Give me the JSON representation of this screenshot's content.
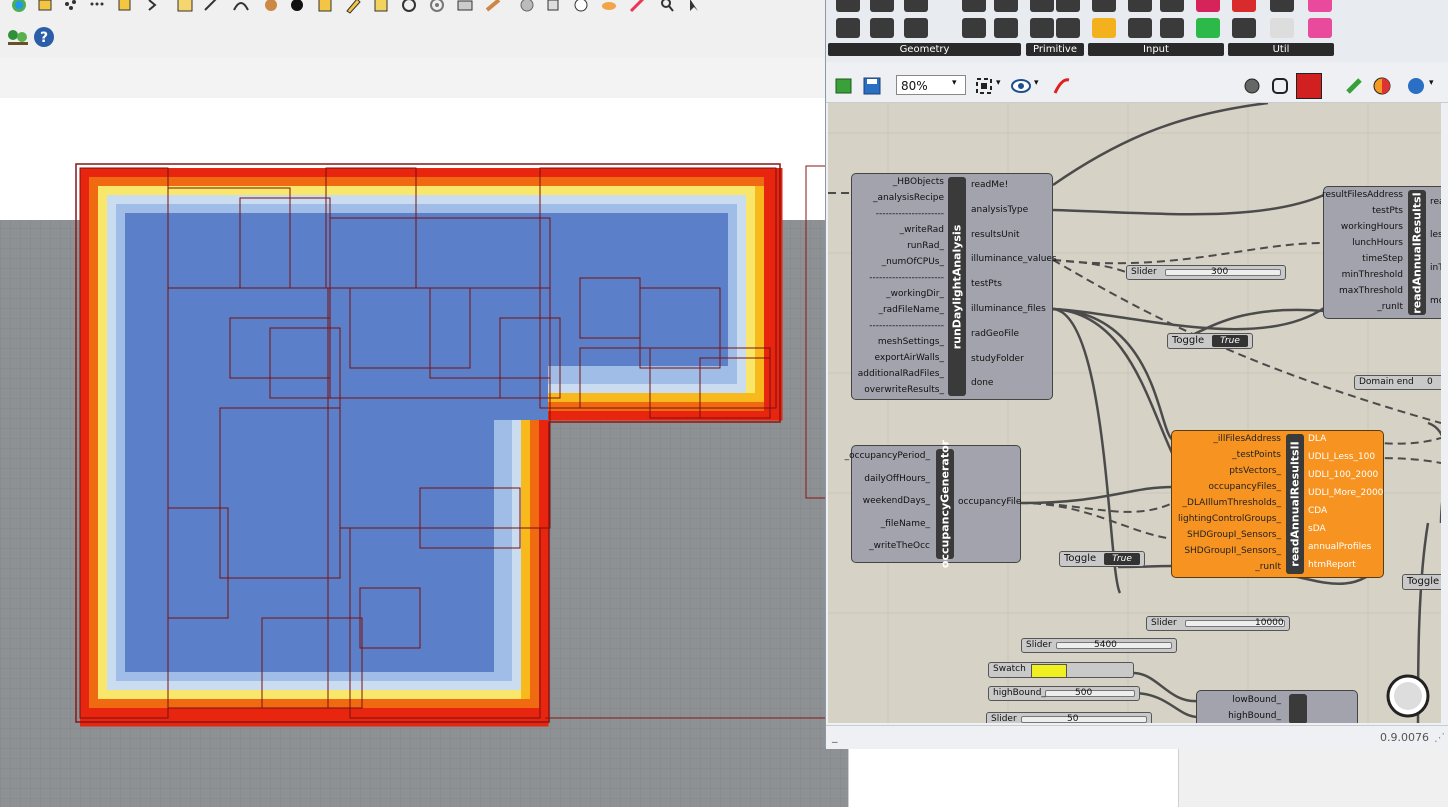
{
  "rhino": {
    "toolbar2": {
      "help_icon": "help-icon",
      "tree_icon": "tree-icon"
    }
  },
  "gh": {
    "ribbon": {
      "groups": [
        {
          "label": "Geometry"
        },
        {
          "label": "Primitive"
        },
        {
          "label": "Input"
        },
        {
          "label": "Util"
        }
      ]
    },
    "toolbar": {
      "zoom": "80%"
    },
    "status": {
      "version": "0.9.0076"
    },
    "components": {
      "run_daylight": {
        "title": "runDaylightAnalysis",
        "inputs": [
          "_HBObjects",
          "_analysisRecipe",
          "---------------------",
          "_writeRad",
          "runRad_",
          "_numOfCPUs_",
          "-----------------------",
          "_workingDir_",
          "_radFileName_",
          "-----------------------",
          "meshSettings_",
          "exportAirWalls_",
          "additionalRadFiles_",
          "overwriteResults_"
        ],
        "outputs": [
          "readMe!",
          "analysisType",
          "resultsUnit",
          "illuminance_values",
          "testPts",
          "illuminance_files",
          "radGeoFile",
          "studyFolder",
          "done"
        ]
      },
      "occupancy": {
        "title": "occupancyGenerator",
        "inputs": [
          "_occupancyPeriod_",
          "dailyOffHours_",
          "weekendDays_",
          "_fileName_",
          "_writeTheOcc"
        ],
        "outputs": [
          "occupancyFile"
        ]
      },
      "read_annual_2": {
        "title": "readAnnualResultsII",
        "inputs": [
          "_illFilesAddress",
          "_testPoints",
          "ptsVectors_",
          "occupancyFiles_",
          "_DLAIllumThresholds_",
          "lightingControlGroups_",
          "SHDGroupI_Sensors_",
          "SHDGroupII_Sensors_",
          "_runIt"
        ],
        "outputs": [
          "DLA",
          "UDLI_Less_100",
          "UDLI_100_2000",
          "UDLI_More_2000",
          "CDA",
          "sDA",
          "annualProfiles",
          "htmReport"
        ]
      },
      "read_annual_1": {
        "title": "readAnnualResultsI",
        "inputs": [
          "resultFilesAddress",
          "testPts",
          "workingHours",
          "lunchHours",
          "timeStep",
          "minThreshold",
          "maxThreshold",
          "_runIt"
        ],
        "outputs": [
          "read",
          "less",
          "inTh",
          "more"
        ]
      },
      "bounds": {
        "inputs": [
          "lowBound_",
          "highBound_"
        ]
      }
    },
    "params": {
      "slider_300": {
        "label": "Slider",
        "value": "300"
      },
      "slider_10000": {
        "label": "Slider",
        "value": "10000"
      },
      "slider_5400": {
        "label": "Slider",
        "value": "5400"
      },
      "slider_50": {
        "label": "Slider",
        "value": "50"
      },
      "highbound": {
        "label": "highBound_",
        "value": "500"
      },
      "swatch": {
        "label": "Swatch",
        "color": "#f0f020"
      },
      "toggle_a": {
        "label": "Toggle",
        "value": "True"
      },
      "toggle_b": {
        "label": "Toggle",
        "value": "True"
      },
      "toggle_c": {
        "label": "Toggle"
      },
      "domain_end": {
        "label": "Domain end",
        "value": "0"
      }
    }
  }
}
